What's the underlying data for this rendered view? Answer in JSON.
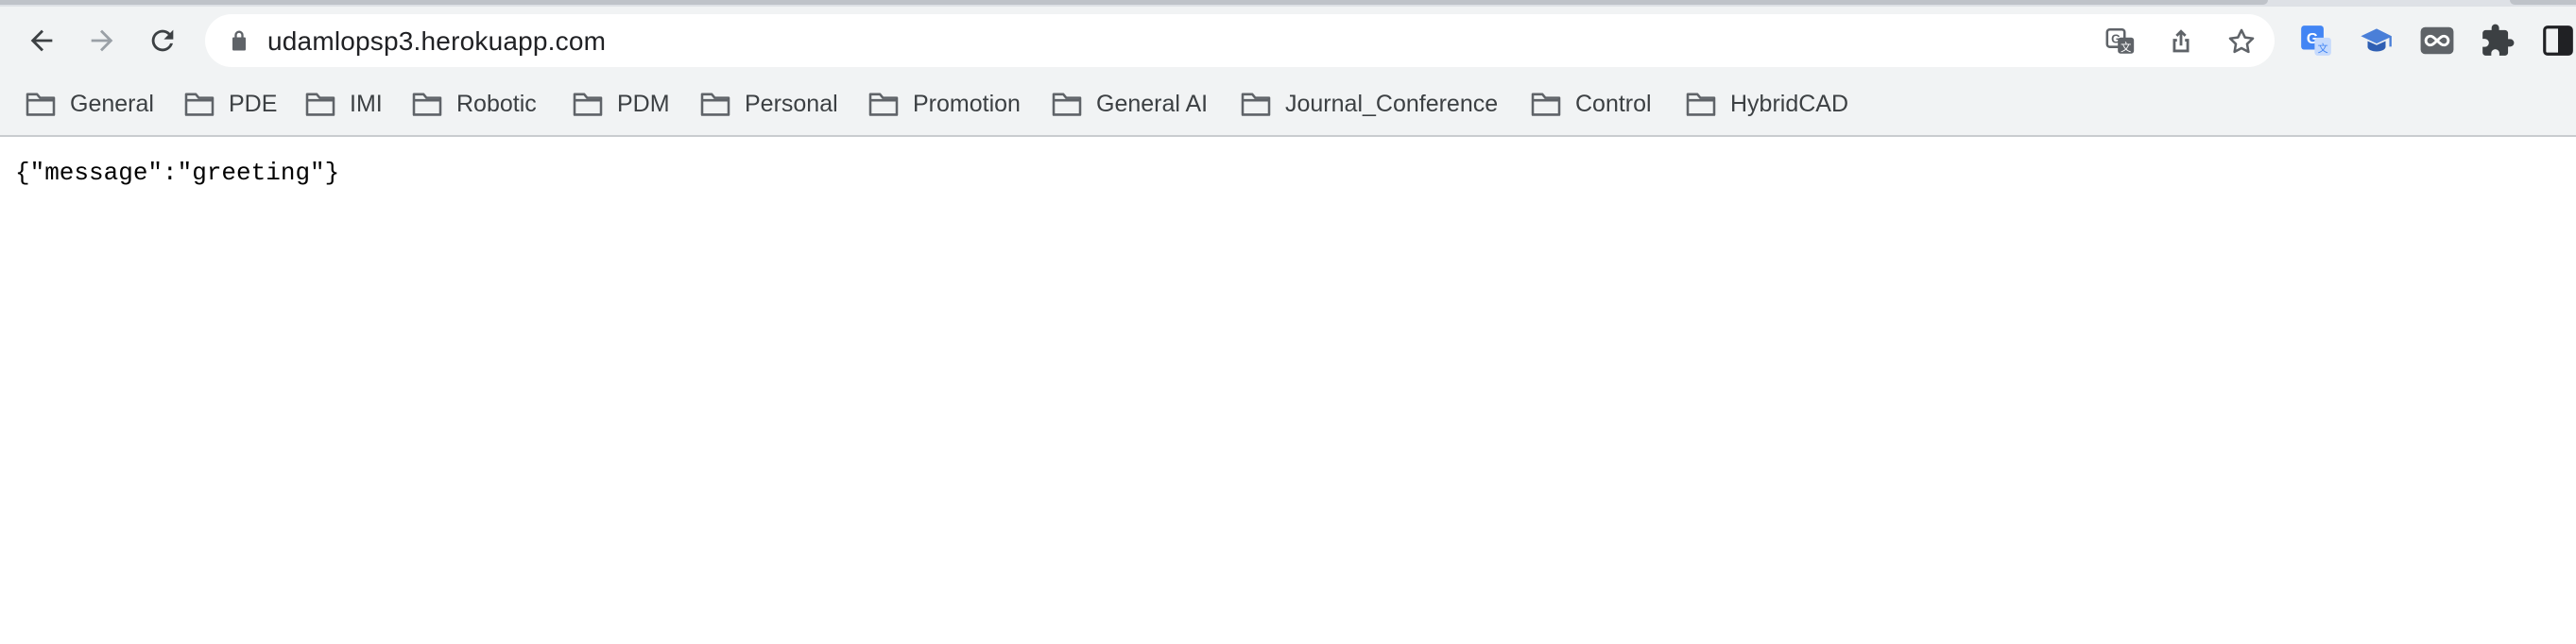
{
  "browser": {
    "url": "udamlopsp3.herokuapp.com",
    "nav": {
      "back": "back-arrow-icon",
      "forward": "forward-arrow-icon",
      "reload": "reload-icon"
    },
    "omnibox_icons": [
      "translate-icon",
      "share-icon",
      "bookmark-star-icon"
    ],
    "extension_icons": [
      "google-translate-extension-icon",
      "graduation-cap-extension-icon",
      "infinity-extension-icon",
      "puzzle-extensions-icon",
      "side-panel-icon"
    ]
  },
  "bookmarks": [
    {
      "label": "General"
    },
    {
      "label": "PDE"
    },
    {
      "label": "IMI"
    },
    {
      "label": "Robotic"
    },
    {
      "label": "PDM"
    },
    {
      "label": "Personal"
    },
    {
      "label": "Promotion"
    },
    {
      "label": "General AI"
    },
    {
      "label": "Journal_Conference"
    },
    {
      "label": "Control"
    },
    {
      "label": "HybridCAD"
    }
  ],
  "page": {
    "body_text": "{\"message\":\"greeting\"}"
  },
  "colors": {
    "toolbar_bg": "#f1f3f4",
    "icon": "#3c4043",
    "translate_blue": "#4285f4"
  }
}
